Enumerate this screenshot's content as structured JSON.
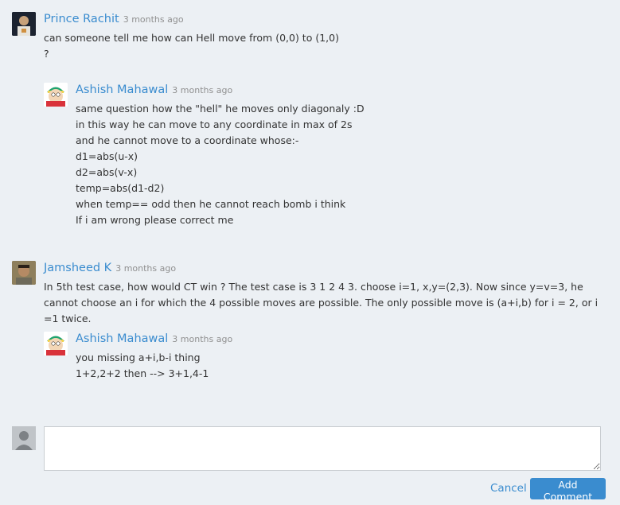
{
  "comments": [
    {
      "author": "Prince Rachit",
      "time": "3 months ago",
      "lines": [
        "can someone tell me how can Hell move from (0,0) to (1,0)",
        "?"
      ]
    },
    {
      "author": "Ashish Mahawal",
      "time": "3 months ago",
      "lines": [
        "same question how the \"hell\" he moves only diagonaly :D",
        "in this way he can move to any coordinate in max of 2s",
        "and he cannot move to a coordinate whose:-",
        "d1=abs(u-x)",
        "d2=abs(v-x)",
        "temp=abs(d1-d2)",
        "when temp== odd then he cannot reach bomb i think",
        "If i am wrong please correct me"
      ]
    },
    {
      "author": "Jamsheed K",
      "time": "3 months ago",
      "text": "In 5th test case, how would CT win ? The test case is 3 1 2 4 3. choose i=1, x,y=(2,3). Now since y=v=3, he cannot choose an i for which the 4 possible moves are possible. The only possible move is (a+i,b) for i = 2, or i =1 twice."
    },
    {
      "author": "Ashish Mahawal",
      "time": "3 months ago",
      "lines": [
        "you missing a+i,b-i thing",
        "1+2,2+2 then --> 3+1,4-1"
      ]
    }
  ],
  "compose": {
    "placeholder": "",
    "cancel_label": "Cancel",
    "submit_label": "Add Comment"
  },
  "colors": {
    "background": "#ecf0f4",
    "author_link": "#3a8ccf",
    "button": "#3a8ccf"
  }
}
